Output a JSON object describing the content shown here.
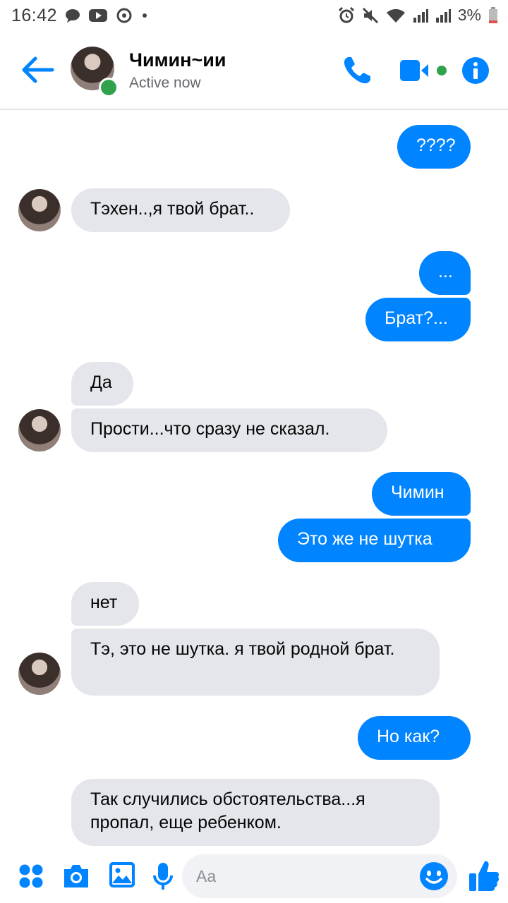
{
  "status_bar": {
    "time": "16:42",
    "battery": "3%",
    "icons": [
      "chat-bubble-icon",
      "youtube-icon",
      "sync-icon",
      "dot-icon",
      "alarm-icon",
      "mute-icon",
      "wifi-icon",
      "signal-icon",
      "signal-icon",
      "battery-icon"
    ]
  },
  "header": {
    "name": "Чимин~ии",
    "status": "Active now",
    "accent": "#0084ff"
  },
  "messages": [
    {
      "from": "me",
      "text": "????"
    },
    {
      "from": "them",
      "text": "Тэхен..,я твой брат.."
    },
    {
      "from": "me",
      "text": "..."
    },
    {
      "from": "me",
      "text": "Брат?..."
    },
    {
      "from": "them",
      "text": "Да"
    },
    {
      "from": "them",
      "text": "Прости...что сразу не сказал."
    },
    {
      "from": "me",
      "text": "Чимин"
    },
    {
      "from": "me",
      "text": "Это же не шутка"
    },
    {
      "from": "them",
      "text": "нет"
    },
    {
      "from": "them",
      "text": "Тэ, это не шутка. я твой родной брат."
    },
    {
      "from": "me",
      "text": "Но как?"
    },
    {
      "from": "them",
      "text": "Так случились обстоятельства...я пропал, еще ребенком."
    }
  ],
  "composer": {
    "placeholder": "Aa"
  }
}
